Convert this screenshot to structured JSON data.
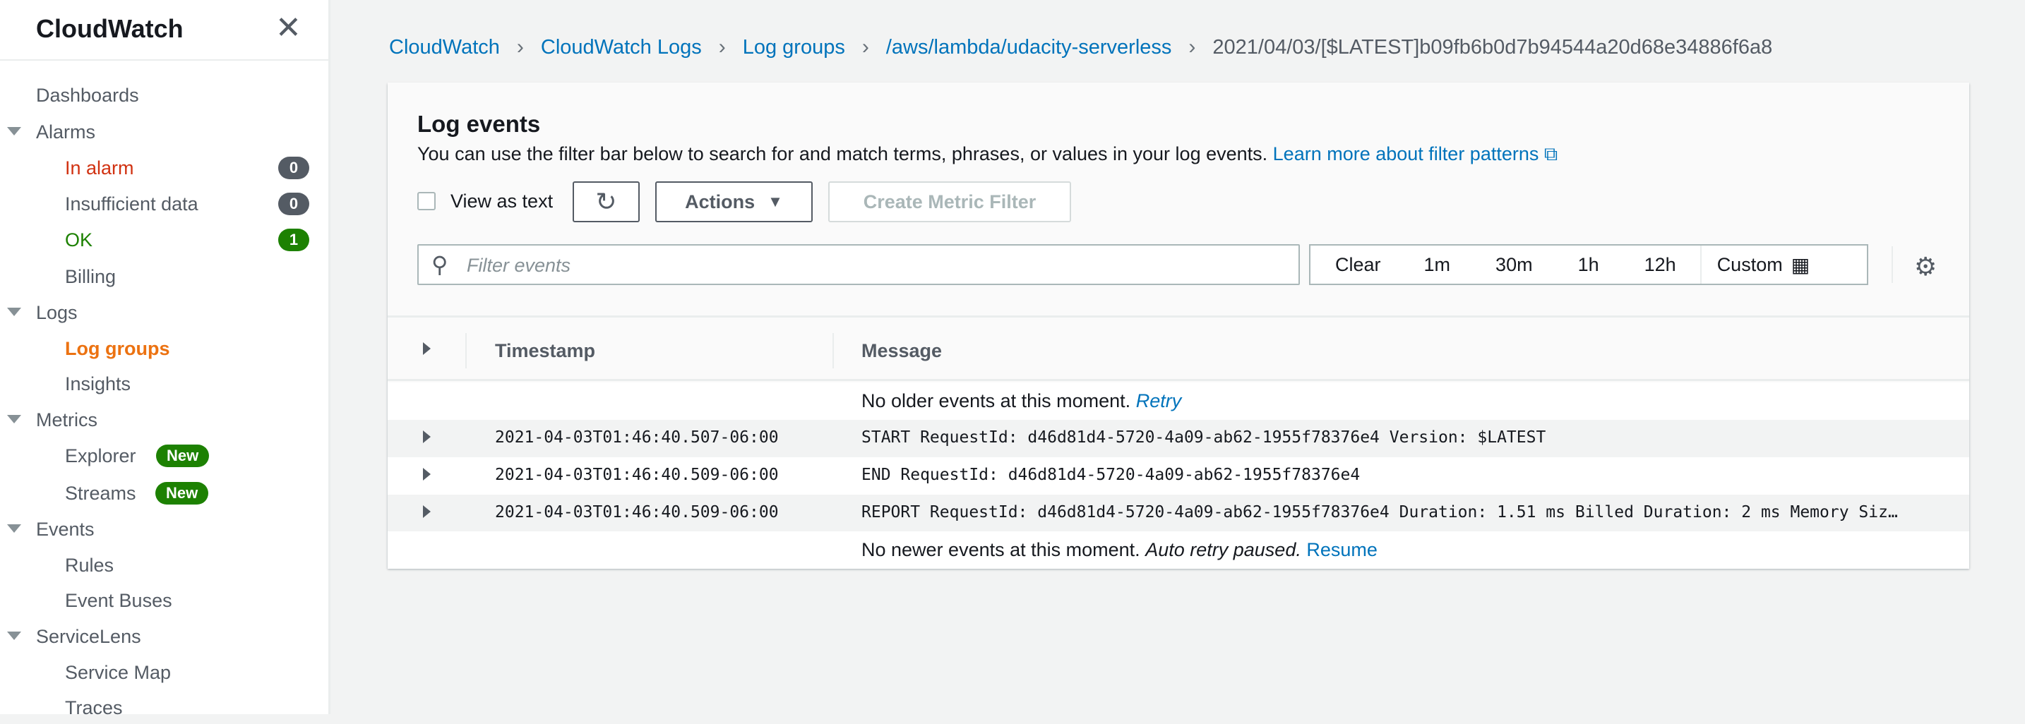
{
  "sidebar": {
    "title": "CloudWatch",
    "items": [
      {
        "label": "Dashboards"
      },
      {
        "label": "Alarms"
      },
      {
        "label": "In alarm",
        "badge": "0"
      },
      {
        "label": "Insufficient data",
        "badge": "0"
      },
      {
        "label": "OK",
        "badge": "1"
      },
      {
        "label": "Billing"
      },
      {
        "label": "Logs"
      },
      {
        "label": "Log groups"
      },
      {
        "label": "Insights"
      },
      {
        "label": "Metrics"
      },
      {
        "label": "Explorer",
        "tag": "New"
      },
      {
        "label": "Streams",
        "tag": "New"
      },
      {
        "label": "Events"
      },
      {
        "label": "Rules"
      },
      {
        "label": "Event Buses"
      },
      {
        "label": "ServiceLens"
      },
      {
        "label": "Service Map"
      },
      {
        "label": "Traces"
      }
    ]
  },
  "breadcrumb": [
    "CloudWatch",
    "CloudWatch Logs",
    "Log groups",
    "/aws/lambda/udacity-serverless",
    "2021/04/03/[$LATEST]b09fb6b0d7b94544a20d68e34886f6a8"
  ],
  "panel": {
    "title": "Log events",
    "description": "You can use the filter bar below to search for and match terms, phrases, or values in your log events.",
    "learn_more": "Learn more about filter patterns",
    "view_as_text": "View as text",
    "actions": "Actions",
    "create_metric_filter": "Create Metric Filter",
    "filter_placeholder": "Filter events",
    "times": [
      "Clear",
      "1m",
      "30m",
      "1h",
      "12h",
      "Custom"
    ]
  },
  "table": {
    "headers": [
      "Timestamp",
      "Message"
    ],
    "no_older": "No older events at this moment.",
    "retry": "Retry",
    "rows": [
      {
        "timestamp": "2021-04-03T01:46:40.507-06:00",
        "message": "START RequestId: d46d81d4-5720-4a09-ab62-1955f78376e4 Version: $LATEST"
      },
      {
        "timestamp": "2021-04-03T01:46:40.509-06:00",
        "message": "END RequestId: d46d81d4-5720-4a09-ab62-1955f78376e4"
      },
      {
        "timestamp": "2021-04-03T01:46:40.509-06:00",
        "message": "REPORT RequestId: d46d81d4-5720-4a09-ab62-1955f78376e4 Duration: 1.51 ms Billed Duration: 2 ms Memory Siz…"
      }
    ],
    "no_newer": "No newer events at this moment.",
    "auto_retry": "Auto retry paused.",
    "resume": "Resume"
  },
  "colors": {
    "accent": "#0073bb",
    "active": "#ec7211",
    "alarm": "#d13212",
    "ok": "#1d8102"
  }
}
